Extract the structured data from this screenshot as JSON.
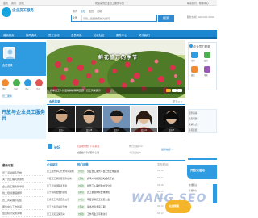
{
  "topbar": {
    "left_links": [
      "首页",
      "资讯",
      "论坛"
    ],
    "welcome": "欢迎来到企业员工服务平台",
    "right_text": "联系我们 | 帮助中心"
  },
  "header": {
    "logo_text": "企业员工服务",
    "search_tabs": [
      "资讯",
      "论坛",
      "会员",
      "活动"
    ],
    "search_select": "全部",
    "search_placeholder": "请输入您要搜索的关键词",
    "search_button": "搜索",
    "phone": "服务热线 400-000-0000"
  },
  "nav": {
    "items": [
      "首页首页",
      "新闻资讯",
      "员工活动",
      "会员风采",
      "论坛社区",
      "服务中心",
      "关于我们"
    ]
  },
  "left": {
    "user_label": "会员登录",
    "icons": [
      "资讯",
      "活动",
      "论坛",
      "会员"
    ],
    "link": "员工服务",
    "promo": "开放与企业员工服务共",
    "section_title": "最新动态",
    "rows": [
      "员工活动报名开始",
      "关于员工福利的通知",
      "企业员工服务新举措",
      "线上培训课程推荐",
      "员工风采展示征集",
      "服务中心工作时间",
      "会员积分兑换说明"
    ]
  },
  "banner": {
    "title": "鲜花盛开的季节",
    "caption": "春季员工户外活动精彩瞬间回顾 · 员工风采展示"
  },
  "members": {
    "title": "会员风采",
    "more": "更多>>",
    "items": [
      {
        "caption": "会员 A"
      },
      {
        "caption": "会员 B"
      },
      {
        "caption": "会员 C"
      },
      {
        "caption": "会员 D"
      },
      {
        "caption": "会员 E"
      }
    ]
  },
  "forum": {
    "label": "论坛",
    "links": [
      "[活动预告] 下午茶会",
      "[经验分享] 职场心得",
      "最新帖子 >"
    ],
    "meta": [
      "昨日发帖 12",
      "今日发帖 8"
    ]
  },
  "list": {
    "head_left": "企业动态",
    "head_mid": "热门话题",
    "head_right": "发布时间",
    "rows": [
      {
        "left": "员工服务中心开放时间说明",
        "cat": "[公告]",
        "title": "企业员工服务平台正式上线运营",
        "meta": "04-18"
      },
      {
        "left": "季度员工满意度调查启动",
        "cat": "[活动]",
        "title": "春季户外拓展活动报名开启",
        "meta": "04-17"
      },
      {
        "left": "员工培训课程表更新",
        "cat": "[交流]",
        "title": "新员工入职经验交流分享",
        "meta": "04-16"
      },
      {
        "left": "关于福利发放的通知",
        "cat": "[资讯]",
        "title": "员工健康体检安排通知",
        "meta": "04-15"
      },
      {
        "left": "优秀员工评选结果公示",
        "cat": "[公告]",
        "title": "年度优秀员工表彰大会",
        "meta": "04-14"
      },
      {
        "left": "员工之家活动室开放",
        "cat": "[活动]",
        "title": "读书分享会第三期",
        "meta": "04-13"
      },
      {
        "left": "员工意见征集活动",
        "cat": "[交流]",
        "title": "工作与生活平衡讨论",
        "meta": "04-12"
      }
    ]
  },
  "right": {
    "title": "企业员工服务",
    "icons": [
      "咨询",
      "投诉",
      "建议",
      "帮助"
    ],
    "rows": [
      "服务指南",
      "常见问题",
      "联系方式",
      "意见反馈",
      "在线留言",
      "下载中心"
    ],
    "promo": "开放式活动"
  },
  "float_button": "在线客服",
  "watermark": "WANG SEO",
  "colors": {
    "primary": "#1b87d1",
    "accent": "#2f9be0",
    "float": "#f5b52b"
  }
}
